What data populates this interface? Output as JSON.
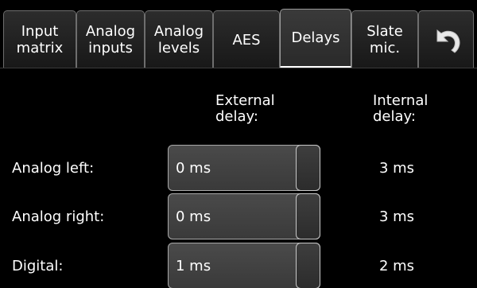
{
  "tabs": [
    {
      "label": "Input\nmatrix",
      "active": false
    },
    {
      "label": "Analog\ninputs",
      "active": false
    },
    {
      "label": "Analog\nlevels",
      "active": false
    },
    {
      "label": "AES",
      "active": false
    },
    {
      "label": "Delays",
      "active": true
    },
    {
      "label": "Slate\nmic.",
      "active": false
    }
  ],
  "back_icon": "undo-arrow-icon",
  "headers": {
    "external": "External\ndelay:",
    "internal": "Internal\ndelay:"
  },
  "rows": [
    {
      "label": "Analog left:",
      "external": "0 ms",
      "internal": "3 ms"
    },
    {
      "label": "Analog right:",
      "external": "0 ms",
      "internal": "3 ms"
    },
    {
      "label": "Digital:",
      "external": "1 ms",
      "internal": "2 ms"
    }
  ]
}
